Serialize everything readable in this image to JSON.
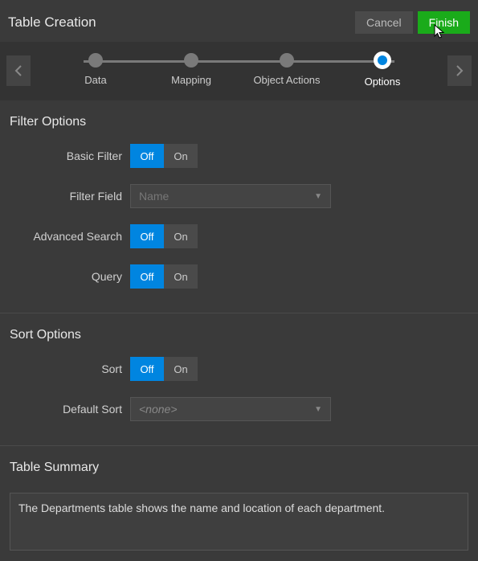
{
  "header": {
    "title": "Table Creation",
    "cancel_label": "Cancel",
    "finish_label": "Finish"
  },
  "stepper": {
    "steps": [
      {
        "label": "Data"
      },
      {
        "label": "Mapping"
      },
      {
        "label": "Object Actions"
      },
      {
        "label": "Options"
      }
    ]
  },
  "filter_section": {
    "title": "Filter Options",
    "basic_filter_label": "Basic Filter",
    "filter_field_label": "Filter Field",
    "filter_field_value": "Name",
    "advanced_search_label": "Advanced Search",
    "query_label": "Query"
  },
  "sort_section": {
    "title": "Sort Options",
    "sort_label": "Sort",
    "default_sort_label": "Default Sort",
    "default_sort_value": "<none>"
  },
  "summary_section": {
    "title": "Table Summary",
    "value": "The Departments table shows the name and location of each department."
  },
  "toggle": {
    "off": "Off",
    "on": "On"
  }
}
